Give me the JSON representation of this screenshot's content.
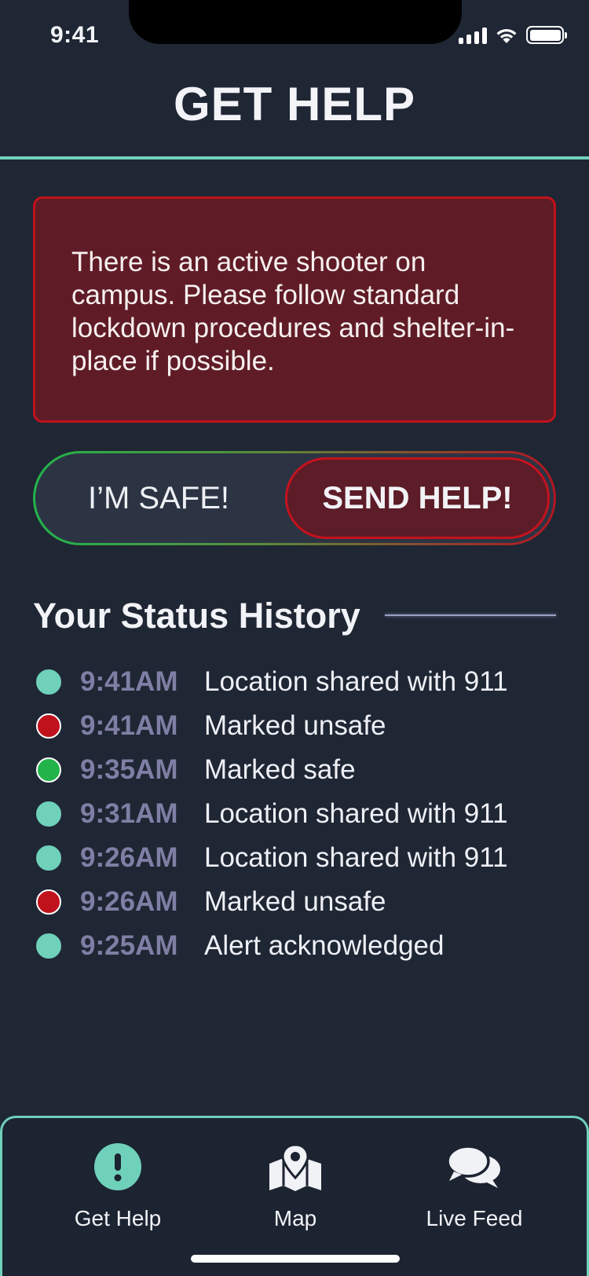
{
  "status_bar": {
    "time": "9:41"
  },
  "header": {
    "title": "GET HELP"
  },
  "alert": {
    "message": "There is an active shooter on campus. Please follow standard lockdown procedures and shelter-in-place if possible."
  },
  "toggle": {
    "safe_label": "I’M SAFE!",
    "help_label": "SEND HELP!"
  },
  "history": {
    "title": "Your Status History",
    "items": [
      {
        "time": "9:41AM",
        "text": "Location shared with 911",
        "status": "info"
      },
      {
        "time": "9:41AM",
        "text": "Marked unsafe",
        "status": "unsafe"
      },
      {
        "time": "9:35AM",
        "text": "Marked safe",
        "status": "safe"
      },
      {
        "time": "9:31AM",
        "text": "Location shared with 911",
        "status": "info"
      },
      {
        "time": "9:26AM",
        "text": "Location shared with 911",
        "status": "info"
      },
      {
        "time": "9:26AM",
        "text": "Marked unsafe",
        "status": "unsafe"
      },
      {
        "time": "9:25AM",
        "text": "Alert acknowledged",
        "status": "info"
      }
    ]
  },
  "nav": [
    {
      "label": "Get Help",
      "icon": "exclamation-circle-icon"
    },
    {
      "label": "Map",
      "icon": "map-pin-icon"
    },
    {
      "label": "Live Feed",
      "icon": "chat-bubbles-icon"
    }
  ],
  "colors": {
    "background": "#1f2634",
    "accent": "#6fd1ba",
    "danger": "#c0121c",
    "safe": "#22b44a",
    "muted_time": "#7f7ea4"
  }
}
